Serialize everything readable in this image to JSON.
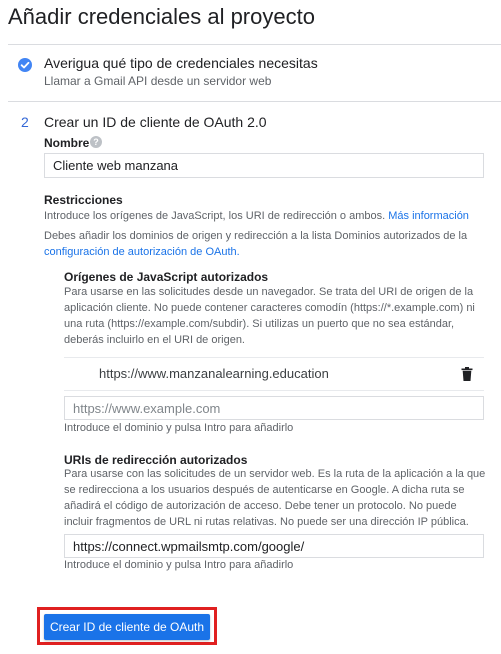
{
  "page": {
    "title": "Añadir credenciales al proyecto"
  },
  "step1": {
    "title": "Averigua qué tipo de credenciales necesitas",
    "subtitle": "Llamar a Gmail API desde un servidor web",
    "icon": "check-circle-icon",
    "icon_color": "#4285f4"
  },
  "step2": {
    "number": "2",
    "title": "Crear un ID de cliente de OAuth 2.0",
    "name_label": "Nombre",
    "name_help_icon": "help-circle-icon",
    "name_value": "Cliente web manzana",
    "restrictions": {
      "title": "Restricciones",
      "description": "Introduce los orígenes de JavaScript, los URI de redirección o ambos.",
      "more_info_link": "Más información",
      "domains_note": "Debes añadir los dominios de origen y redirección a la lista Dominios autorizados de la",
      "consent_link": "configuración de autorización de OAuth."
    },
    "js_origins": {
      "title": "Orígenes de JavaScript autorizados",
      "desc_lines": [
        "Para usarse en las solicitudes desde un navegador. Se trata del URI de origen de la",
        "aplicación cliente. No puede contener caracteres comodín (https://*.example.com) ni",
        "una ruta (https://example.com/subdir). Si utilizas un puerto que no sea estándar,",
        "deberás incluirlo en el URI de origen."
      ],
      "existing_origin": "https://www.manzanalearning.education",
      "delete_icon": "trash-icon",
      "input_placeholder": "https://www.example.com",
      "input_value": "",
      "hint": "Introduce el dominio y pulsa Intro para añadirlo"
    },
    "redirect_uris": {
      "title": "URIs de redirección autorizados",
      "desc_lines": [
        "Para usarse con las solicitudes de un servidor web. Es la ruta de la aplicación a la que",
        "se redirecciona a los usuarios después de autenticarse en Google. A dicha ruta se",
        "añadirá el código de autorización de acceso. Debe tener un protocolo. No puede",
        "incluir fragmentos de URL ni rutas relativas. No puede ser una dirección IP pública."
      ],
      "input_value": "https://connect.wpmailsmtp.com/google/",
      "hint": "Introduce el dominio y pulsa Intro para añadirlo"
    },
    "create_button_label": "Crear ID de cliente de OAuth"
  },
  "colors": {
    "accent": "#1a73e8",
    "highlight": "#e02020"
  }
}
